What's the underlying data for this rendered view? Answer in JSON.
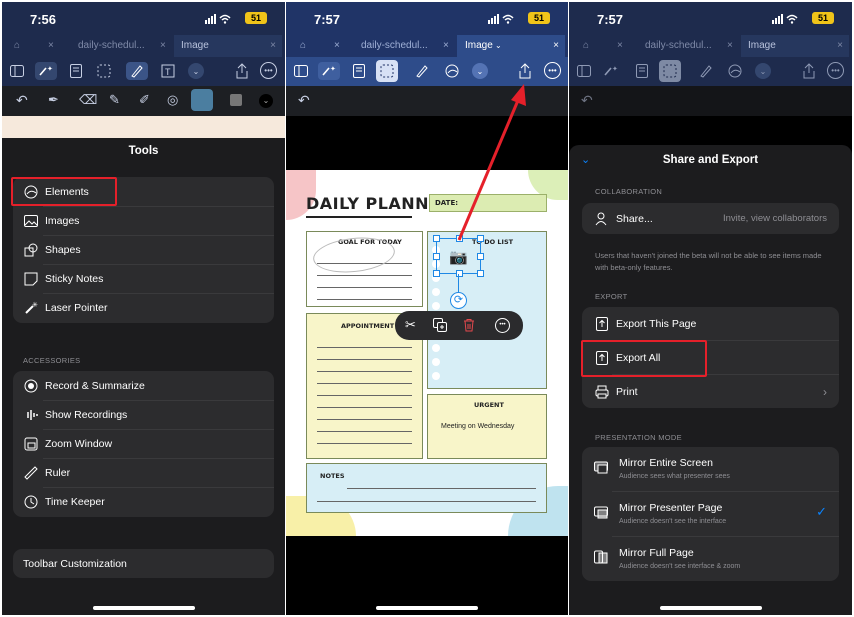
{
  "panel1": {
    "time": "7:56",
    "battery": "51",
    "tabs": [
      "daily-schedul...",
      "Image"
    ],
    "sheet_title": "Tools",
    "tools": [
      "Elements",
      "Images",
      "Shapes",
      "Sticky Notes",
      "Laser Pointer"
    ],
    "accessories_header": "ACCESSORIES",
    "accessories": [
      "Record & Summarize",
      "Show Recordings",
      "Zoom Window",
      "Ruler",
      "Time Keeper"
    ],
    "toolbar_customization": "Toolbar Customization"
  },
  "panel2": {
    "time": "7:57",
    "battery": "51",
    "tabs": [
      "daily-schedul...",
      "Image"
    ],
    "planner": {
      "title": "DAILY PLANNER",
      "date_label": "DATE:",
      "goal_label": "GOAL FOR TODAY",
      "todo_label": "TO DO LIST",
      "appointment_label": "APPOINTMENT",
      "urgent_label": "URGENT",
      "urgent_text": "Meeting on Wednesday",
      "notes_label": "NOTES"
    }
  },
  "panel3": {
    "time": "7:57",
    "battery": "51",
    "tabs": [
      "daily-schedul...",
      "Image"
    ],
    "sheet_title": "Share and Export",
    "collab_header": "COLLABORATION",
    "share_label": "Share...",
    "share_hint": "Invite, view collaborators",
    "beta_note": "Users that haven't joined the beta will not be able to see items made with beta-only features.",
    "export_header": "EXPORT",
    "export_items": [
      "Export This Page",
      "Export All",
      "Print"
    ],
    "presentation_header": "PRESENTATION MODE",
    "presentation": [
      {
        "title": "Mirror Entire Screen",
        "desc": "Audience sees what presenter sees"
      },
      {
        "title": "Mirror Presenter Page",
        "desc": "Audience doesn't see the interface"
      },
      {
        "title": "Mirror Full Page",
        "desc": "Audience doesn't see interface & zoom"
      }
    ]
  },
  "colors": {
    "highlight": "#e5202a",
    "accent": "#0a84ff",
    "toolbar_blue": "#1f3159"
  }
}
